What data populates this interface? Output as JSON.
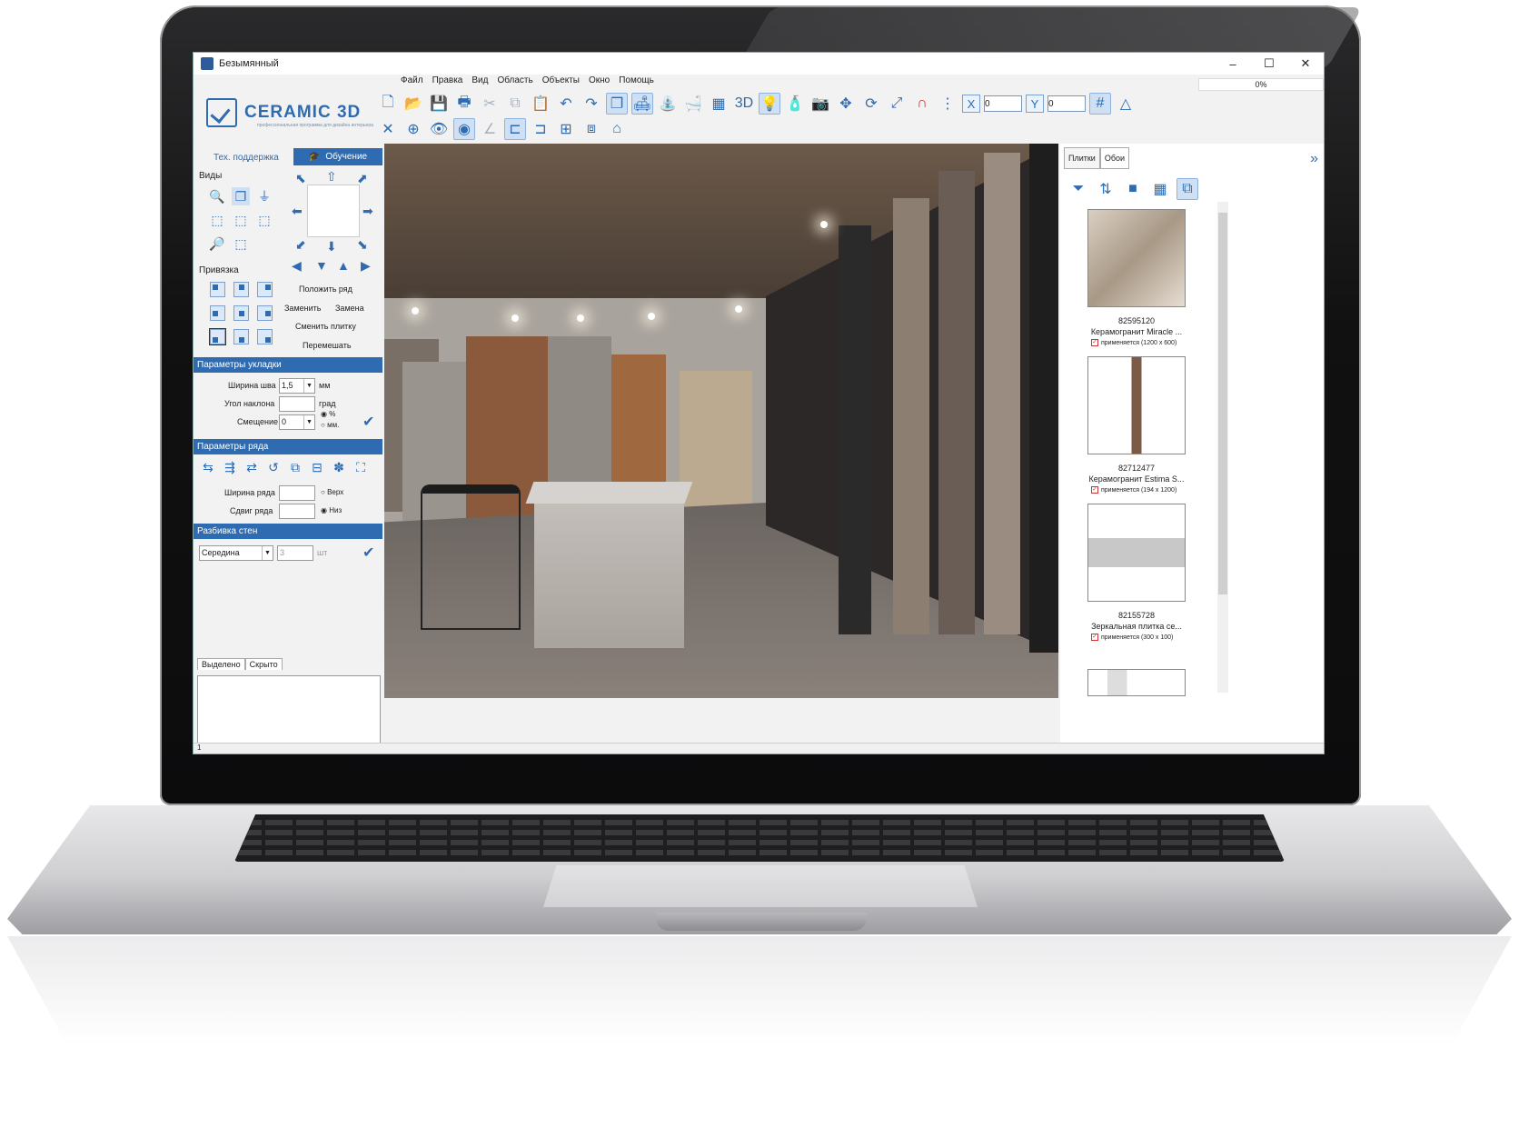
{
  "window": {
    "title": "Безымянный",
    "progress": "0%"
  },
  "menu": [
    "Файл",
    "Правка",
    "Вид",
    "Область",
    "Объекты",
    "Окно",
    "Помощь"
  ],
  "logo": {
    "text": "CERAMIC 3D",
    "subtitle": "профессиональная программа для дизайна интерьера"
  },
  "coords": {
    "x_label": "X",
    "x_value": "0",
    "y_label": "Y",
    "y_value": "0"
  },
  "left": {
    "support": "Тех. поддержка",
    "learn": "Обучение",
    "views_label": "Виды",
    "snap_label": "Привязка",
    "actions": {
      "lay_row": "Положить ряд",
      "replace": "Заменить",
      "replacement": "Замена",
      "change_tile": "Сменить плитку",
      "shuffle": "Перемешать"
    },
    "layout_params": {
      "title": "Параметры укладки",
      "seam_label": "Ширина шва",
      "seam_value": "1,5",
      "seam_unit": "мм",
      "angle_label": "Угол наклона",
      "angle_value": "",
      "angle_unit": "град",
      "offset_label": "Смещение",
      "offset_value": "0",
      "pct": "%",
      "mm": "мм."
    },
    "row_params": {
      "title": "Параметры ряда",
      "row_width_label": "Ширина ряда",
      "row_width_value": "",
      "row_shift_label": "Сдвиг ряда",
      "row_shift_value": "",
      "top": "Верх",
      "bottom": "Низ"
    },
    "walls": {
      "title": "Разбивка стен",
      "mode": "Середина",
      "count": "3",
      "unit": "шт"
    },
    "tabs": [
      "Выделено",
      "Скрыто"
    ],
    "status": "1"
  },
  "right": {
    "tabs": [
      "Плитки",
      "Обои"
    ],
    "tiles": [
      {
        "code": "82595120",
        "name": "Керамогранит Miracle ...",
        "apply": "применяется (1200 x 600)"
      },
      {
        "code": "82712477",
        "name": "Керамогранит Estima S...",
        "apply": "применяется (194 x 1200)"
      },
      {
        "code": "82155728",
        "name": "Зеркальная плитка се...",
        "apply": "применяется (300 x 100)"
      }
    ]
  },
  "colors": {
    "accent": "#2e6bb0",
    "frame": "#111111"
  }
}
